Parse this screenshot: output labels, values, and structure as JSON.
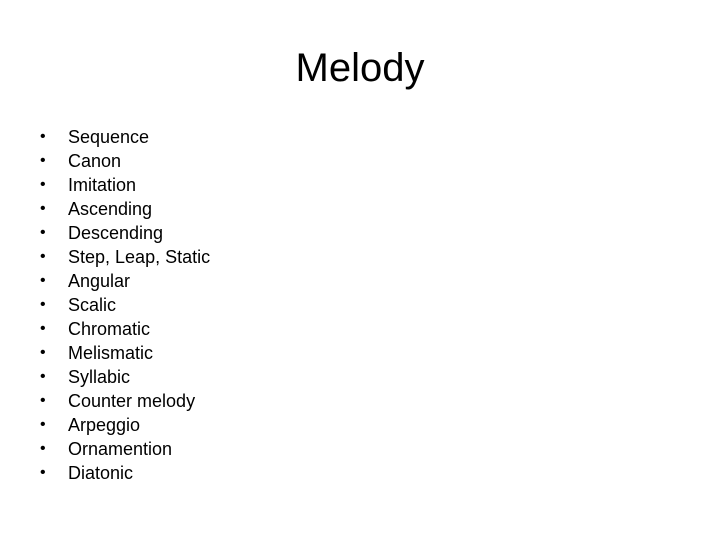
{
  "slide": {
    "title": "Melody",
    "background_color": "#ffffff",
    "text_color": "#000000",
    "bullet_glyph": "•",
    "bullet_icon_name": "bullet-dot-icon",
    "items": [
      {
        "label": "Sequence"
      },
      {
        "label": "Canon"
      },
      {
        "label": "Imitation"
      },
      {
        "label": "Ascending"
      },
      {
        "label": "Descending"
      },
      {
        "label": "Step, Leap, Static"
      },
      {
        "label": "Angular"
      },
      {
        "label": "Scalic"
      },
      {
        "label": "Chromatic"
      },
      {
        "label": "Melismatic"
      },
      {
        "label": "Syllabic"
      },
      {
        "label": "Counter melody"
      },
      {
        "label": "Arpeggio"
      },
      {
        "label": "Ornamention"
      },
      {
        "label": "Diatonic"
      }
    ]
  }
}
